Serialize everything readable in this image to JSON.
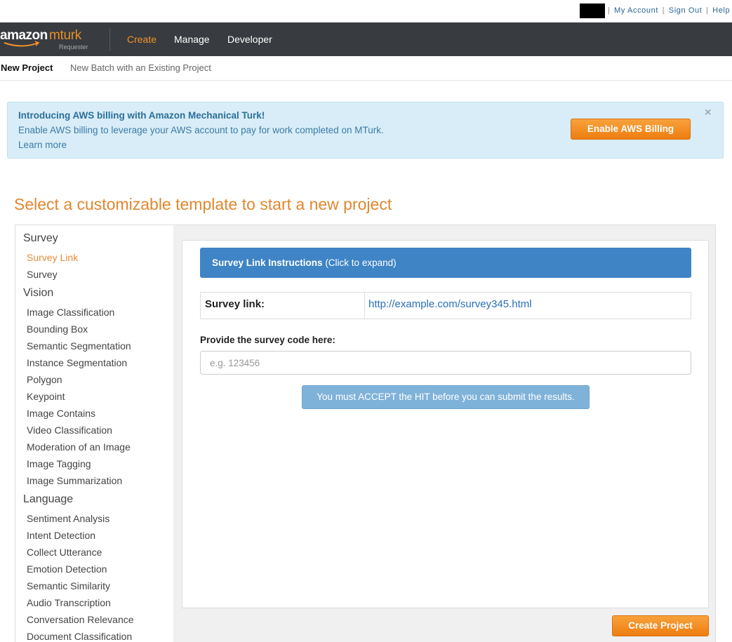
{
  "topbar": {
    "links": [
      "My Account",
      "Sign Out",
      "Help"
    ]
  },
  "logo": {
    "amazon": "amazon",
    "mturk": "mturk",
    "subtitle": "Requester"
  },
  "nav": {
    "items": [
      "Create",
      "Manage",
      "Developer"
    ],
    "active": "Create"
  },
  "subnav": {
    "items": [
      "New Project",
      "New Batch with an Existing Project"
    ],
    "active": "New Project"
  },
  "banner": {
    "title": "Introducing AWS billing with Amazon Mechanical Turk!",
    "text": "Enable AWS billing to leverage your AWS account to pay for work completed on MTurk.",
    "link": "Learn more",
    "button": "Enable AWS Billing",
    "close": "×"
  },
  "heading": "Select a customizable template to start a new project",
  "sidebar": {
    "categories": [
      {
        "name": "Survey",
        "items": [
          "Survey Link",
          "Survey"
        ]
      },
      {
        "name": "Vision",
        "items": [
          "Image Classification",
          "Bounding Box",
          "Semantic Segmentation",
          "Instance Segmentation",
          "Polygon",
          "Keypoint",
          "Image Contains",
          "Video Classification",
          "Moderation of an Image",
          "Image Tagging",
          "Image Summarization"
        ]
      },
      {
        "name": "Language",
        "items": [
          "Sentiment Analysis",
          "Intent Detection",
          "Collect Utterance",
          "Emotion Detection",
          "Semantic Similarity",
          "Audio Transcription",
          "Conversation Relevance",
          "Document Classification"
        ]
      }
    ],
    "active_item": "Survey Link"
  },
  "preview": {
    "instructions_title": "Survey Link Instructions",
    "instructions_hint": "(Click to expand)",
    "link_label": "Survey link:",
    "link_value": "http://example.com/survey345.html",
    "code_label": "Provide the survey code here:",
    "code_placeholder": "e.g. 123456",
    "accept_notice": "You must ACCEPT the HIT before you can submit the results."
  },
  "create_button": "Create Project",
  "colors": {
    "accent_orange": "#e0872e",
    "nav_bg": "#383b3f",
    "banner_bg": "#d8edf7",
    "instructions_blue": "#3f84c5"
  }
}
